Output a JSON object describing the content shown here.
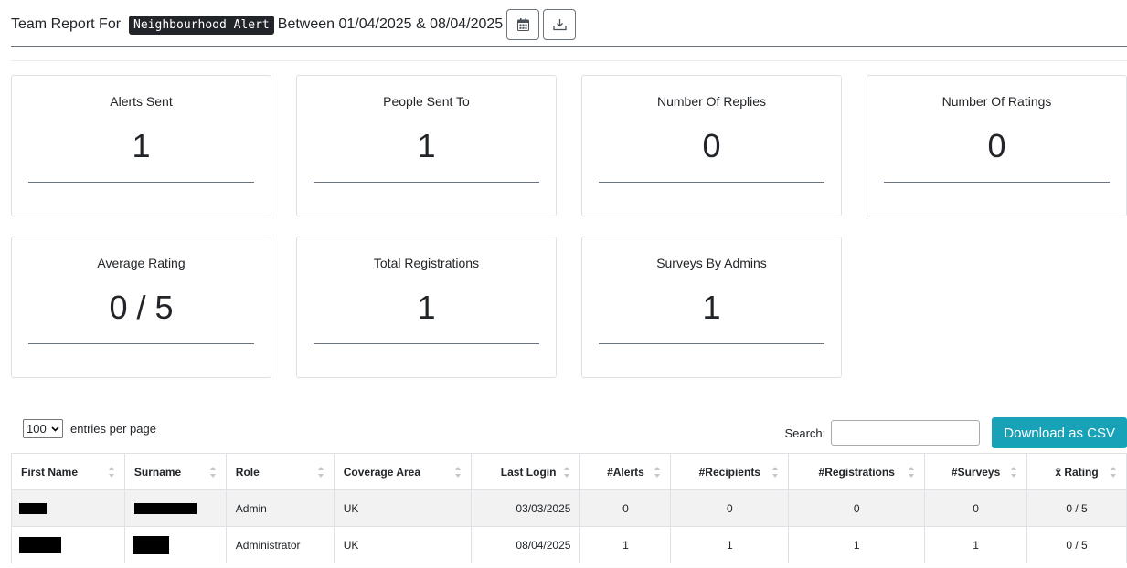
{
  "header": {
    "prefix": "Team Report For",
    "team_name": "Neighbourhood Alert",
    "suffix": "Between 01/04/2025 & 08/04/2025",
    "calendar_icon": "calendar-icon",
    "download_icon": "download-icon"
  },
  "stats": [
    {
      "label": "Alerts Sent",
      "value": "1"
    },
    {
      "label": "People Sent To",
      "value": "1"
    },
    {
      "label": "Number Of Replies",
      "value": "0"
    },
    {
      "label": "Number Of Ratings",
      "value": "0"
    },
    {
      "label": "Average Rating",
      "value": "0 / 5"
    },
    {
      "label": "Total Registrations",
      "value": "1"
    },
    {
      "label": "Surveys By Admins",
      "value": "1"
    }
  ],
  "table_controls": {
    "entries_value": "100",
    "entries_label": "entries per page",
    "search_label": "Search:",
    "search_value": "",
    "csv_button": "Download as CSV"
  },
  "table": {
    "columns": [
      "First Name",
      "Surname",
      "Role",
      "Coverage Area",
      "Last Login",
      "#Alerts",
      "#Recipients",
      "#Registrations",
      "#Surveys",
      "x̄ Rating"
    ],
    "rows": [
      {
        "role": "Admin",
        "coverage": "UK",
        "last_login": "03/03/2025",
        "alerts": "0",
        "recipients": "0",
        "registrations": "0",
        "surveys": "0",
        "rating": "0 / 5"
      },
      {
        "role": "Administrator",
        "coverage": "UK",
        "last_login": "08/04/2025",
        "alerts": "1",
        "recipients": "1",
        "registrations": "1",
        "surveys": "1",
        "rating": "0 / 5"
      }
    ]
  },
  "colors": {
    "accent": "#17a2b8",
    "badge_bg": "#212529",
    "stripe": "#f2f2f2"
  }
}
